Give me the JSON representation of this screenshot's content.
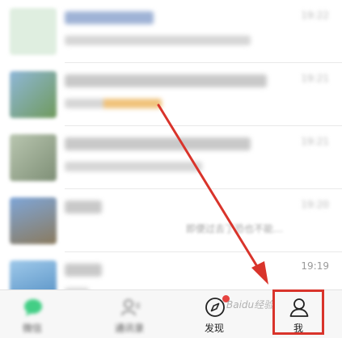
{
  "chat_list": {
    "times": [
      "19:19"
    ],
    "row4_sub": "即便过去了恐也不能…"
  },
  "tabbar": {
    "tabs": [
      {
        "label": "微信"
      },
      {
        "label": "通讯录"
      },
      {
        "label": "发现"
      },
      {
        "label": "我"
      }
    ]
  },
  "watermark": "Baidu经验",
  "colors": {
    "highlight": "#d9342b",
    "arrow": "#d9342b",
    "wechat_green": "#07c160"
  },
  "icons": {
    "discover": "compass-icon",
    "me": "person-icon",
    "contacts": "contacts-icon",
    "chats": "chat-bubble-icon"
  }
}
